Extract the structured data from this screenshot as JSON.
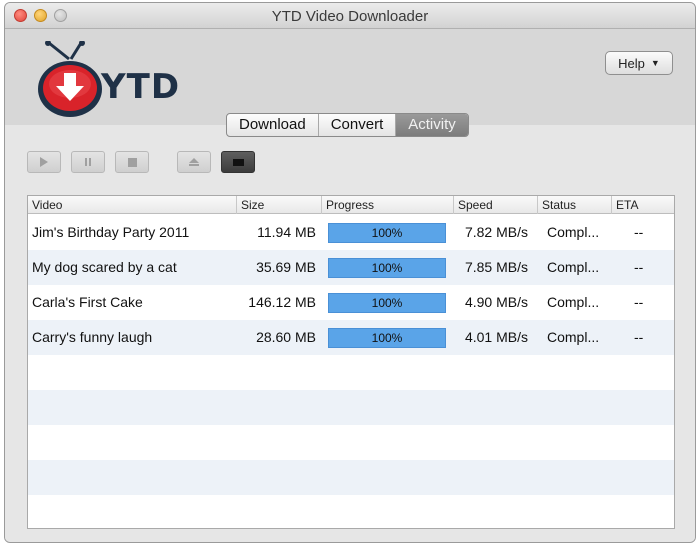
{
  "window": {
    "title": "YTD Video Downloader"
  },
  "header": {
    "logo_text": "YTD",
    "help_label": "Help"
  },
  "tabs": [
    {
      "label": "Download",
      "active": false
    },
    {
      "label": "Convert",
      "active": false
    },
    {
      "label": "Activity",
      "active": true
    }
  ],
  "toolbar": {
    "buttons": [
      "play-icon",
      "pause-icon",
      "stop-icon",
      "eject-icon",
      "folder-icon"
    ]
  },
  "table": {
    "columns": [
      "Video",
      "Size",
      "Progress",
      "Speed",
      "Status",
      "ETA"
    ],
    "rows": [
      {
        "video": "Jim's Birthday Party 2011",
        "size": "11.94 MB",
        "progress": "100%",
        "progress_value": 1.0,
        "speed": "7.82 MB/s",
        "status": "Compl...",
        "eta": "--"
      },
      {
        "video": "My dog scared by a cat",
        "size": "35.69 MB",
        "progress": "100%",
        "progress_value": 1.0,
        "speed": "7.85 MB/s",
        "status": "Compl...",
        "eta": "--"
      },
      {
        "video": "Carla's First Cake",
        "size": "146.12 MB",
        "progress": "100%",
        "progress_value": 1.0,
        "speed": "4.90 MB/s",
        "status": "Compl...",
        "eta": "--"
      },
      {
        "video": "Carry's funny laugh",
        "size": "28.60 MB",
        "progress": "100%",
        "progress_value": 1.0,
        "speed": "4.01 MB/s",
        "status": "Compl...",
        "eta": "--"
      }
    ]
  },
  "colors": {
    "progress_fill": "#5aa4e8",
    "row_alt": "#edf2f8",
    "logo_red": "#d9232a",
    "logo_navy": "#1f3147"
  }
}
